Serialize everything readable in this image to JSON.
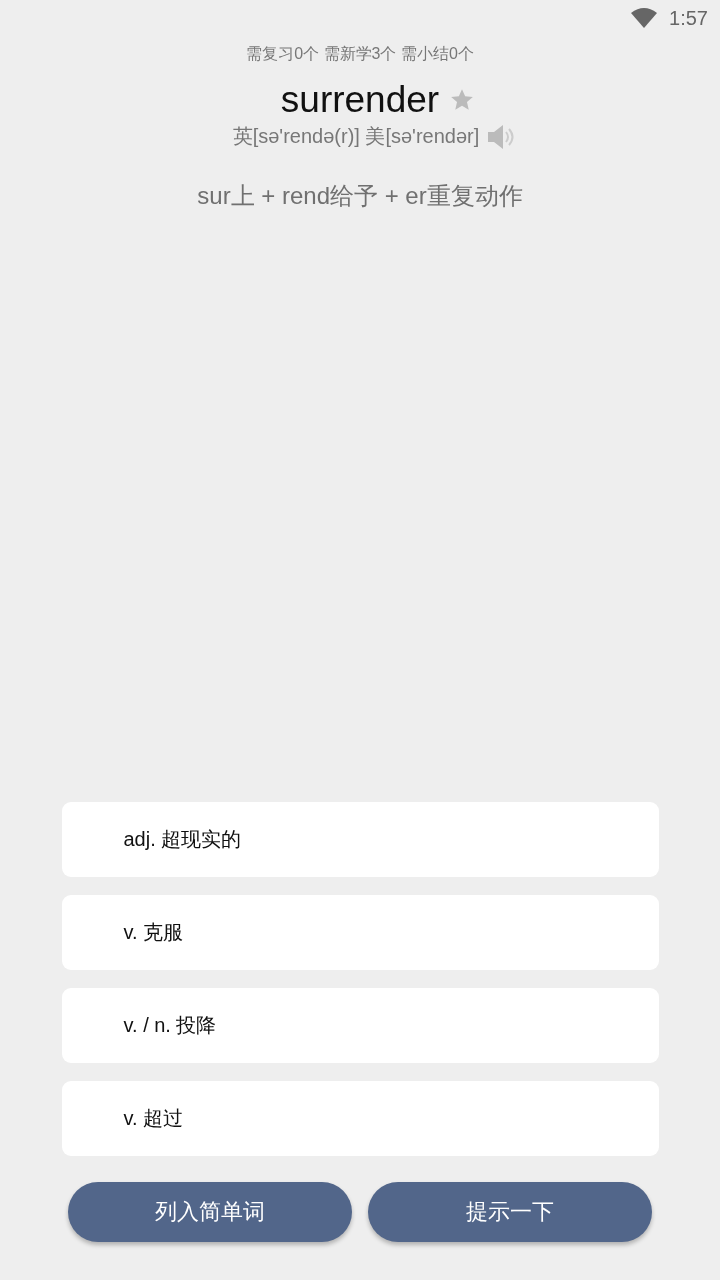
{
  "status_bar": {
    "time": "1:57"
  },
  "progress": "需复习0个 需新学3个 需小结0个",
  "word": {
    "text": "surrender",
    "starred": false,
    "phonetic": "英[sə'rendə(r)] 美[sə'rendər]"
  },
  "etymology": "sur上 + rend给予 + er重复动作",
  "options": [
    {
      "label": "adj. 超现实的"
    },
    {
      "label": "v. 克服"
    },
    {
      "label": "v. / n. 投降"
    },
    {
      "label": "v. 超过"
    }
  ],
  "buttons": [
    "列入简单词",
    "提示一下"
  ]
}
